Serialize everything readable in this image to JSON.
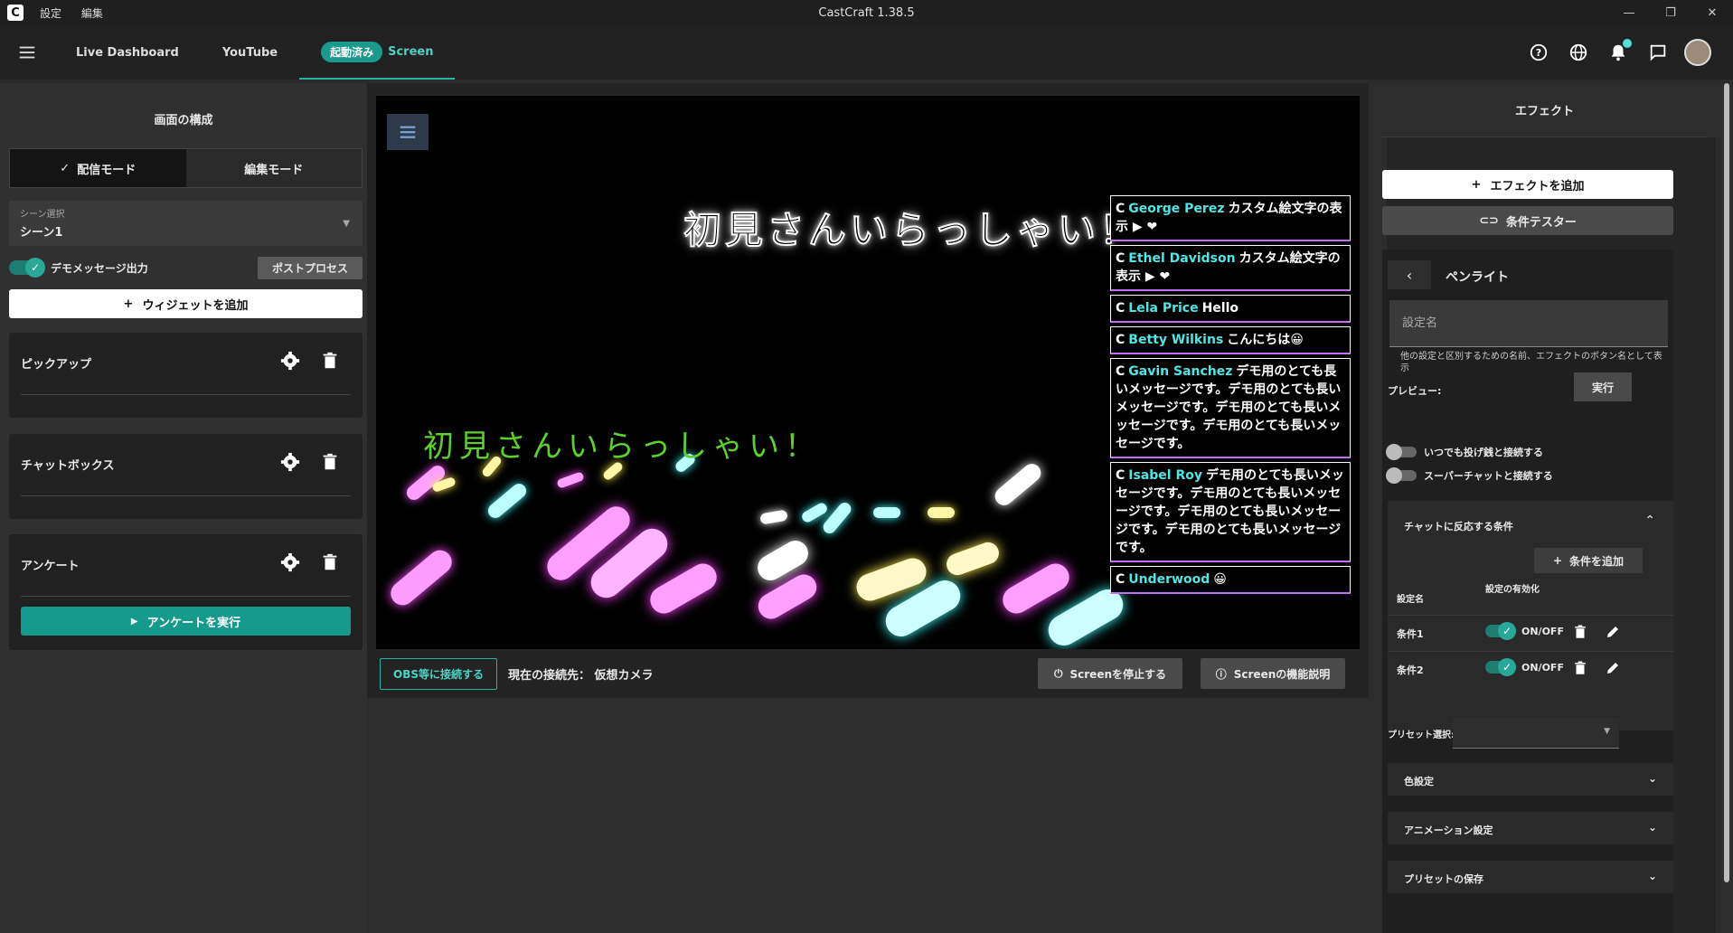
{
  "window": {
    "title": "CastCraft 1.38.5",
    "menu": [
      "設定",
      "編集"
    ]
  },
  "nav": {
    "tabs": [
      {
        "label": "Live Dashboard"
      },
      {
        "label": "YouTube"
      },
      {
        "badge": "起動済み",
        "label": "Screen"
      }
    ]
  },
  "left": {
    "title": "画面の構成",
    "mode_stream": "配信モード",
    "mode_edit": "編集モード",
    "scene_label": "シーン選択",
    "scene_value": "シーン1",
    "demo_label": "デモメッセージ出力",
    "post_label": "ポストプロセス",
    "add_widget": "ウィジェットを追加",
    "widgets": [
      "ピックアップ",
      "チャットボックス",
      "アンケート"
    ],
    "run_poll": "アンケートを実行"
  },
  "stage": {
    "big_title": "初見さんいらっしゃい！",
    "green_title": "初見さんいらっしゃい！",
    "chat": [
      {
        "name": "George Perez",
        "text": "カスタム絵文字の表示 ▶ ❤"
      },
      {
        "name": "Ethel Davidson",
        "text": "カスタム絵文字の表示 ▶ ❤"
      },
      {
        "name": "Lela Price",
        "text": "Hello"
      },
      {
        "name": "Betty Wilkins",
        "text": "こんにちは😀"
      },
      {
        "name": "Gavin Sanchez",
        "text": "デモ用のとても長いメッセージです。デモ用のとても長いメッセージです。デモ用のとても長いメッセージです。デモ用のとても長いメッセージです。"
      },
      {
        "name": "Isabel Roy",
        "text": "デモ用のとても長いメッセージです。デモ用のとても長いメッセージです。デモ用のとても長いメッセージです。デモ用のとても長いメッセージです。"
      },
      {
        "name": "Underwood",
        "text": "😀"
      }
    ]
  },
  "bottom": {
    "obs": "OBS等に接続する",
    "conn": "現在の接続先： 仮想カメラ",
    "stop": "Screenを停止する",
    "help": "Screenの機能説明"
  },
  "right": {
    "title": "エフェクト",
    "add_effect": "エフェクトを追加",
    "tester": "条件テスター",
    "effect_name": "ペンライト",
    "setting_placeholder": "設定名",
    "hint": "他の設定と区別するための名前、エフェクトのボタン名として表示",
    "preview": "プレビュー:",
    "exec": "実行",
    "sw1": "いつでも投げ銭と接続する",
    "sw2": "スーパーチャットと接続する",
    "cond_title": "チャットに反応する条件",
    "add_cond": "条件を追加",
    "th_name": "設定名",
    "th_enable": "設定の有効化",
    "conds": [
      {
        "name": "条件1",
        "state": "ON/OFF"
      },
      {
        "name": "条件2",
        "state": "ON/OFF"
      }
    ],
    "preset_label": "プリセット選択:",
    "acc": [
      "色設定",
      "アニメーション設定",
      "プリセットの保存"
    ]
  }
}
